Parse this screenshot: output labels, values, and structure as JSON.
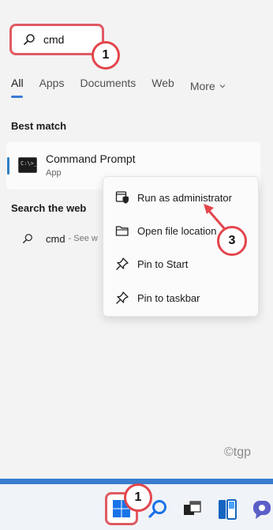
{
  "search": {
    "query": "cmd"
  },
  "callouts": {
    "search_step": "1",
    "menu_step": "3",
    "start_step": "1"
  },
  "tabs": [
    {
      "label": "All",
      "active": true
    },
    {
      "label": "Apps"
    },
    {
      "label": "Documents"
    },
    {
      "label": "Web"
    },
    {
      "label": "More"
    }
  ],
  "best_match": {
    "title": "Best match",
    "app_name": "Command Prompt",
    "app_type": "App",
    "icon": "command-prompt-icon"
  },
  "web": {
    "title": "Search the web",
    "query": "cmd",
    "suffix": "- See w"
  },
  "context_menu": {
    "items": [
      {
        "label": "Run as administrator",
        "icon": "shield-icon"
      },
      {
        "label": "Open file location",
        "icon": "folder-icon"
      },
      {
        "label": "Pin to Start",
        "icon": "pin-icon"
      },
      {
        "label": "Pin to taskbar",
        "icon": "pin-icon"
      }
    ]
  },
  "watermark": "©tgp",
  "taskbar": {
    "items": [
      "windows-start-icon",
      "search-icon",
      "task-view-icon",
      "widgets-icon",
      "teams-chat-icon"
    ]
  },
  "colors": {
    "callout_red": "#e3454c",
    "highlight_border": "#e05a63",
    "accent_blue": "#2f7fc1",
    "taskbar_strip": "#3a7ccf",
    "windows_blue": "#1a73e8"
  }
}
